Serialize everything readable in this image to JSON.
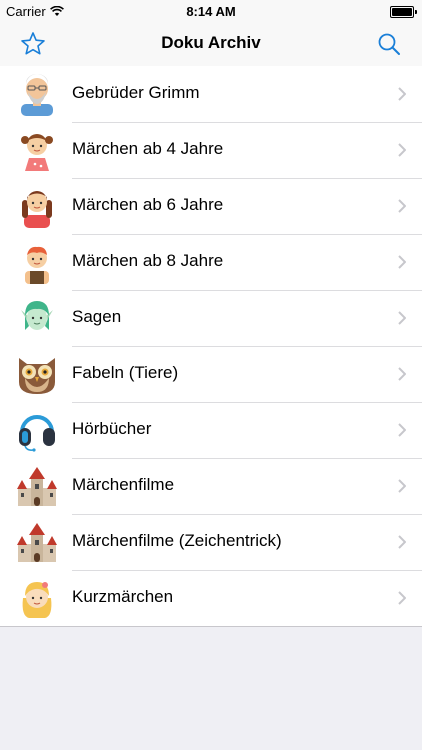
{
  "status_bar": {
    "carrier": "Carrier",
    "time": "8:14 AM"
  },
  "nav": {
    "title": "Doku Archiv",
    "left_icon": "star-icon",
    "right_icon": "search-icon"
  },
  "colors": {
    "accent": "#1a7fd8",
    "chevron": "#c7c7cc",
    "separator": "#dcdcdf",
    "background": "#efeff4"
  },
  "items": [
    {
      "label": "Gebrüder Grimm",
      "icon": "old-man-avatar-icon"
    },
    {
      "label": "Märchen ab 4 Jahre",
      "icon": "little-girl-avatar-icon"
    },
    {
      "label": "Märchen ab 6 Jahre",
      "icon": "girl-braids-avatar-icon"
    },
    {
      "label": "Märchen ab 8 Jahre",
      "icon": "boy-avatar-icon"
    },
    {
      "label": "Sagen",
      "icon": "elf-avatar-icon"
    },
    {
      "label": "Fabeln (Tiere)",
      "icon": "owl-icon"
    },
    {
      "label": "Hörbücher",
      "icon": "headphones-icon"
    },
    {
      "label": "Märchenfilme",
      "icon": "castle-icon"
    },
    {
      "label": "Märchenfilme (Zeichentrick)",
      "icon": "castle-icon"
    },
    {
      "label": "Kurzmärchen",
      "icon": "blonde-girl-avatar-icon"
    }
  ]
}
